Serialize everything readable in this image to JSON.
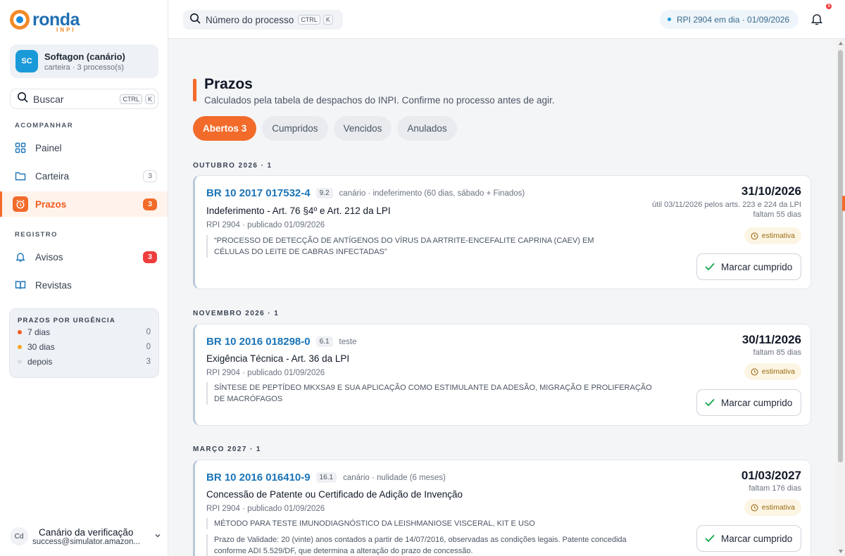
{
  "brand": {
    "name": "ronda",
    "sub": "INPI"
  },
  "account": {
    "initials": "SC",
    "name": "Softagon (canário)",
    "sub": "carteira · 3 processo(s)"
  },
  "sidebar_search": {
    "label": "Buscar",
    "kbd1": "CTRL",
    "kbd2": "K"
  },
  "sections": {
    "follow": "ACOMPANHAR",
    "registry": "REGISTRO"
  },
  "nav": {
    "painel": {
      "label": "Painel"
    },
    "carteira": {
      "label": "Carteira",
      "count": "3"
    },
    "prazos": {
      "label": "Prazos",
      "count": "3"
    },
    "avisos": {
      "label": "Avisos",
      "count": "3"
    },
    "revistas": {
      "label": "Revistas"
    }
  },
  "urgency": {
    "title": "PRAZOS POR URGÊNCIA",
    "rows": [
      {
        "label": "7 dias",
        "count": "0",
        "color": "#f25b1e"
      },
      {
        "label": "30 dias",
        "count": "0",
        "color": "#f5a623"
      },
      {
        "label": "depois",
        "count": "3",
        "color": "#d9dde3"
      }
    ]
  },
  "user": {
    "initials": "Cd",
    "name": "Canário da verificação",
    "email": "success@simulator.amazon..."
  },
  "header": {
    "search_label": "Número do processo",
    "kbd1": "CTRL",
    "kbd2": "K",
    "rpi_status": "RPI 2904 em dia · 01/09/2026",
    "bell_count": "3"
  },
  "page": {
    "title": "Prazos",
    "subtitle": "Calculados pela tabela de despachos do INPI. Confirme no processo antes de agir.",
    "tabs": [
      {
        "label": "Abertos 3",
        "active": true
      },
      {
        "label": "Cumpridos",
        "active": false
      },
      {
        "label": "Vencidos",
        "active": false
      },
      {
        "label": "Anulados",
        "active": false
      }
    ]
  },
  "groups": [
    {
      "label": "OUTUBRO 2026 · 1",
      "card": {
        "number": "BR 10 2017 017532-4",
        "code": "9.2",
        "note": "canário · indeferimento (60 dias, sábado + Finados)",
        "title": "Indeferimento - Art. 76 §4º e Art. 212 da LPI",
        "rpi": "RPI 2904 · publicado 01/09/2026",
        "quote": "“PROCESSO DE DETECÇÃO DE ANTÍGENOS DO VÍRUS DA ARTRITE-ENCEFALITE CAPRINA (CAEV) EM CÉLULAS DO LEITE DE CABRAS INFECTADAS”",
        "due": "31/10/2026",
        "util": "útil 03/11/2026 pelos arts. 223 e 224 da LPI",
        "left": "faltam 55 dias",
        "badge": "estimativa",
        "button": "Marcar cumprido"
      }
    },
    {
      "label": "NOVEMBRO 2026 · 1",
      "card": {
        "number": "BR 10 2016 018298-0",
        "code": "6.1",
        "note": "teste",
        "title": "Exigência Técnica - Art. 36 da LPI",
        "rpi": "RPI 2904 · publicado 01/09/2026",
        "quote": "SÍNTESE DE PEPTÍDEO MKXSA9 E SUA APLICAÇÃO COMO ESTIMULANTE DA ADESÃO, MIGRAÇÃO E PROLIFERAÇÃO DE MACRÓFAGOS",
        "due": "30/11/2026",
        "left": "faltam 85 dias",
        "badge": "estimativa",
        "button": "Marcar cumprido"
      }
    },
    {
      "label": "MARÇO 2027 · 1",
      "card": {
        "number": "BR 10 2016 016410-9",
        "code": "16.1",
        "note": "canário · nulidade (6 meses)",
        "title": "Concessão de Patente ou Certificado de Adição de Invenção",
        "rpi": "RPI 2904 · publicado 01/09/2026",
        "quote": "MÉTODO PARA TESTE IMUNODIAGNÓSTICO DA LEISHMANIOSE VISCERAL, KIT E USO",
        "extra": "Prazo de Validade: 20 (vinte) anos contados a partir de 14/07/2016, observadas as condições legais. Patente concedida conforme ADI 5.529/DF, que determina a alteração do prazo de concessão.",
        "due": "01/03/2027",
        "left": "faltam 176 dias",
        "badge": "estimativa",
        "button": "Marcar cumprido"
      }
    }
  ],
  "colors": {
    "accent": "#f26b2a",
    "link": "#1a74b8",
    "danger": "#ef3d3d"
  }
}
